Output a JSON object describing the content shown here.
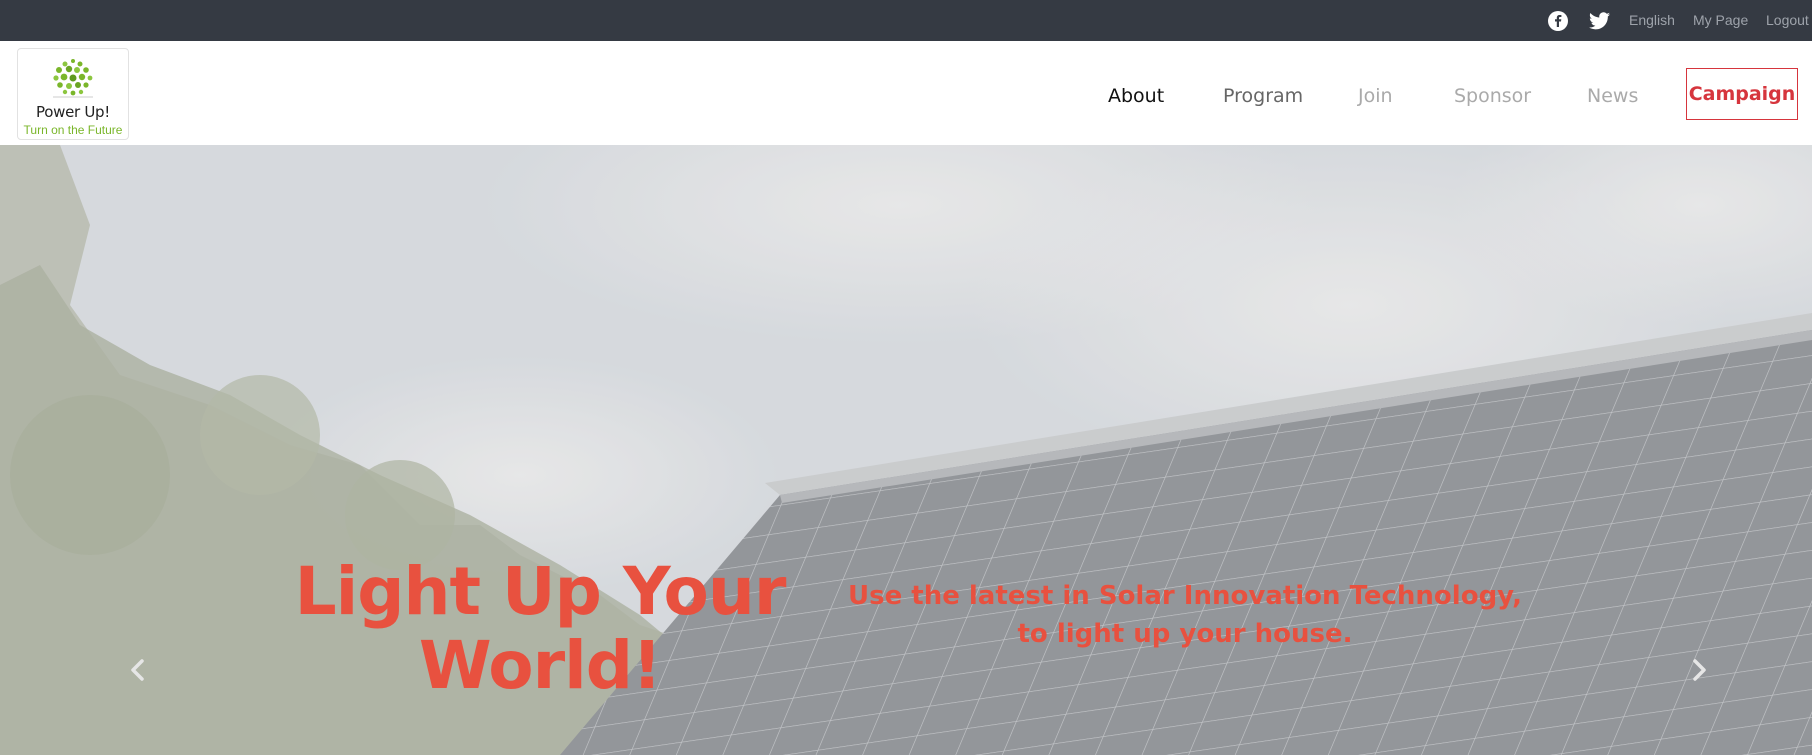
{
  "topbar": {
    "social": [
      "facebook-icon",
      "twitter-icon"
    ],
    "language": "English",
    "my_page": "My Page",
    "logout": "Logout"
  },
  "logo": {
    "brand": "Power Up!",
    "tagline": "Turn on the Future"
  },
  "nav": {
    "about": "About",
    "program": "Program",
    "join": "Join",
    "sponsor": "Sponsor",
    "news": "News",
    "campaign": "Campaign"
  },
  "hero": {
    "title": "Light Up Your World!",
    "subtitle": "Use the latest in Solar Innovation Technology, to light up your house.",
    "prev_icon": "chevron-left-icon",
    "next_icon": "chevron-right-icon"
  },
  "colors": {
    "topbar": "#353a43",
    "accent": "#e8513f",
    "campaign": "#d6353d",
    "logo_green": "#7ab62a"
  }
}
